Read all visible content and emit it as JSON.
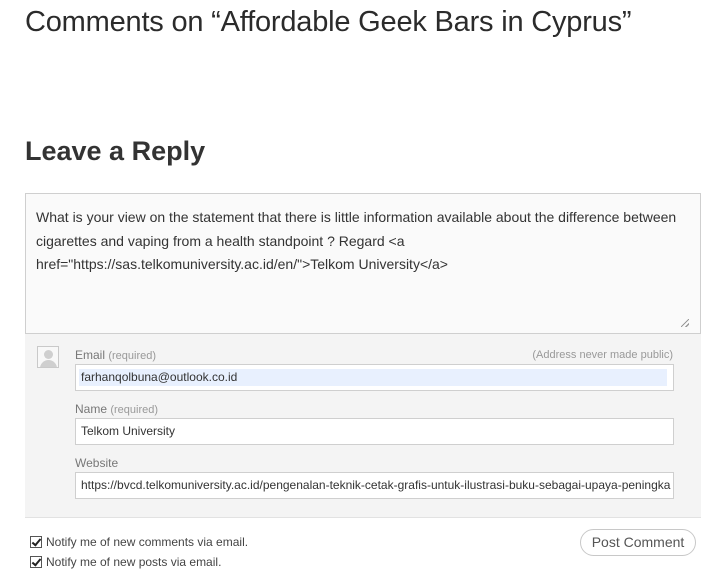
{
  "comments_title": "Comments on “Affordable Geek Bars in Cyprus”",
  "reply_title": "Leave a Reply",
  "comment": {
    "text": "What is your view on the statement that there is little information available about the difference between cigarettes and vaping from a health standpoint ? Regard <a href=\"https://sas.telkomuniversity.ac.id/en/\">Telkom University</a>"
  },
  "form": {
    "email": {
      "label": "Email",
      "required": "(required)",
      "note": "(Address never made public)",
      "value": "farhanqolbuna@outlook.co.id"
    },
    "name": {
      "label": "Name",
      "required": "(required)",
      "value": "Telkom University"
    },
    "website": {
      "label": "Website",
      "value": "https://bvcd.telkomuniversity.ac.id/pengenalan-teknik-cetak-grafis-untuk-ilustrasi-buku-sebagai-upaya-peningka"
    }
  },
  "notify_comments": {
    "label": "Notify me of new comments via email.",
    "checked": true
  },
  "notify_posts": {
    "label": "Notify me of new posts via email.",
    "checked": true
  },
  "post_button": "Post Comment"
}
